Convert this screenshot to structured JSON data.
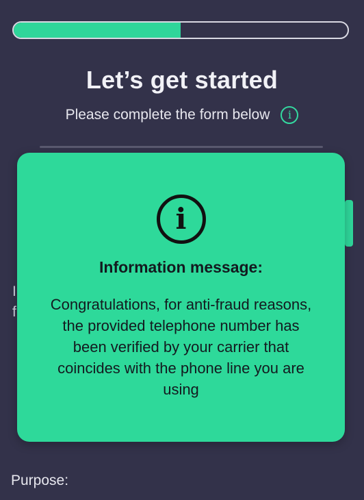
{
  "progress": {
    "fraction": 0.5,
    "fill_color": "#2fd69a",
    "track_color": "#d9d9e3"
  },
  "header": {
    "title": "Let’s get started",
    "subtitle": "Please complete the form below",
    "info_icon": "info-circle-icon"
  },
  "background_fields": {
    "line1_char": "I",
    "line2_char": "f",
    "purpose_label": "Purpose:"
  },
  "modal": {
    "icon": "info-circle-icon",
    "title": "Information message:",
    "message": "Congratulations, for anti-fraud reasons, the provided telephone number has been verified by your carrier that coincides with the phone line you are using",
    "background": "#2ed99a"
  },
  "colors": {
    "page_background": "#33324a",
    "accent": "#2fd69a"
  }
}
